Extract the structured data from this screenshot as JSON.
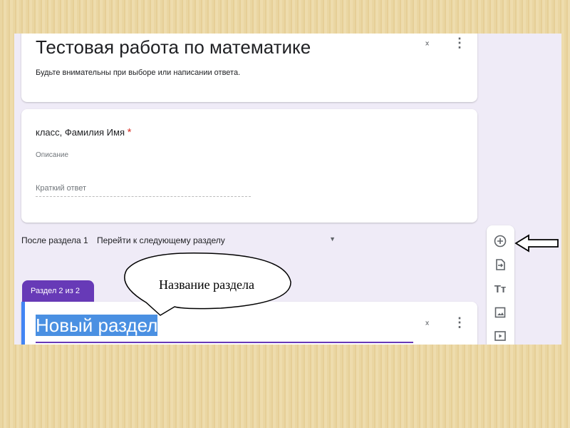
{
  "form": {
    "title": "Тестовая работа по математике",
    "description": "Будьте внимательны при выборе или написании ответа."
  },
  "question": {
    "title": "класс, Фамилия Имя",
    "required_mark": "*",
    "description_placeholder": "Описание",
    "answer_placeholder": "Краткий ответ"
  },
  "navigation": {
    "after_label": "После раздела 1",
    "action": "Перейти к следующему разделу"
  },
  "section": {
    "tab_label": "Раздел 2 из 2",
    "title": "Новый раздел"
  },
  "callout": {
    "text": "Название раздела"
  },
  "toolbar": {
    "items": [
      "add-question-icon",
      "import-questions-icon",
      "add-title-icon",
      "add-image-icon",
      "add-video-icon"
    ]
  },
  "colors": {
    "accent": "#673ab7",
    "selection": "#4a90e2",
    "required": "#d93025",
    "background": "#efebf7"
  }
}
